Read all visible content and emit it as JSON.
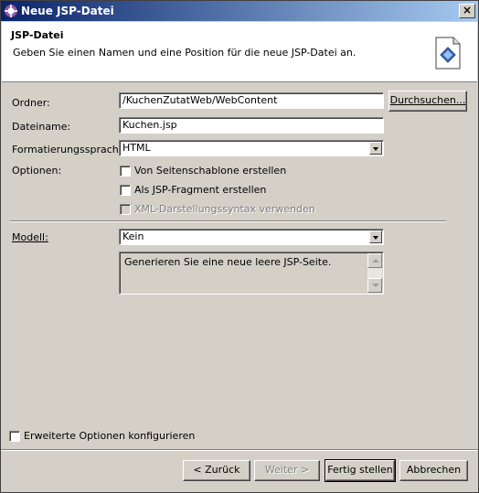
{
  "window": {
    "title": "Neue JSP-Datei",
    "close_label": "×"
  },
  "header": {
    "title": "JSP-Datei",
    "description": "Geben Sie einen Namen und eine Position für die neue JSP-Datei an."
  },
  "form": {
    "folder_label": "Ordner:",
    "folder_value": "/KuchenZutatWeb/WebContent",
    "browse_label": "Durchsuchen...",
    "filename_label": "Dateiname:",
    "filename_value": "Kuchen.jsp",
    "markup_label": "Formatierungssprache:",
    "markup_value": "HTML",
    "options_label": "Optionen:",
    "options": [
      {
        "label": "Von Seitenschablone erstellen",
        "checked": false,
        "enabled": true
      },
      {
        "label": "Als JSP-Fragment erstellen",
        "checked": false,
        "enabled": true
      },
      {
        "label": "XML-Darstellungssyntax verwenden",
        "checked": false,
        "enabled": false
      }
    ],
    "model_label": "Modell:",
    "model_value": "Kein",
    "model_description": "Generieren Sie eine neue leere JSP-Seite."
  },
  "advanced_label": "Erweiterte Optionen konfigurieren",
  "buttons": {
    "back": "< Zurück",
    "next": "Weiter >",
    "finish": "Fertig stellen",
    "cancel": "Abbrechen"
  },
  "colors": {
    "titlebar_start": "#0a246a",
    "titlebar_end": "#a6caf0",
    "dialog_bg": "#d4d0c8"
  }
}
